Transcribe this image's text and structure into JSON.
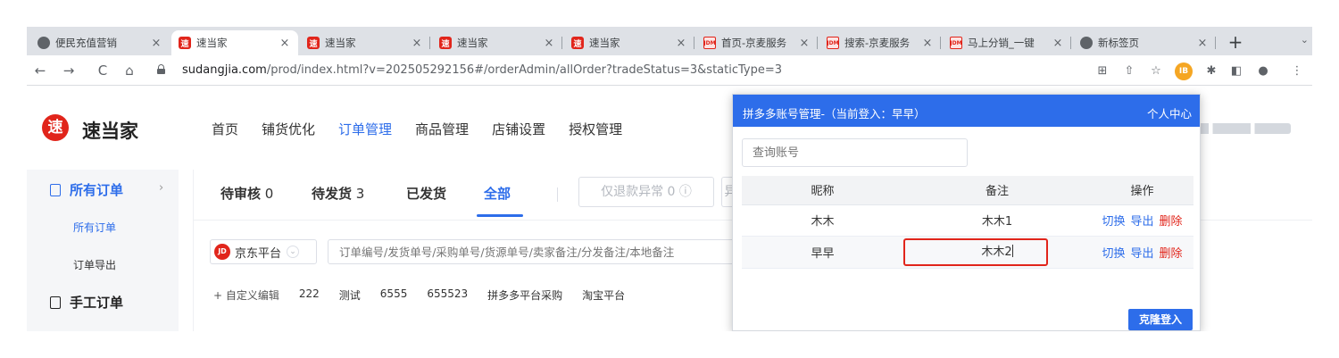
{
  "browser": {
    "tabs": [
      {
        "title": "便民充值营销",
        "icon": "globe-icon",
        "close": "×"
      },
      {
        "title": "速当家",
        "icon": "sudangjia-favicon-icon",
        "close": "×"
      },
      {
        "title": "速当家",
        "icon": "sudangjia-favicon-icon",
        "close": "×"
      },
      {
        "title": "速当家",
        "icon": "sudangjia-favicon-icon",
        "close": "×"
      },
      {
        "title": "速当家",
        "icon": "sudangjia-favicon-icon",
        "close": "×"
      },
      {
        "title": "首页-京麦服务",
        "icon": "jdm-favicon-icon",
        "close": "×"
      },
      {
        "title": "搜索-京麦服务",
        "icon": "jdm-favicon-icon",
        "close": "×"
      },
      {
        "title": "马上分销_一键",
        "icon": "jdm-favicon-icon",
        "close": "×"
      },
      {
        "title": "新标签页",
        "icon": "chrome-icon",
        "close": "×"
      }
    ],
    "active_tab": 1,
    "new_tab": "+",
    "tab_menu": "⌄",
    "favicon_text": "速",
    "jdm_text": "JDM",
    "url_host": "sudangjia.com",
    "url_path": "/prod/index.html?v=202505292156#/orderAdmin/allOrder?tradeStatus=3&staticType=3",
    "nav": {
      "back": "←",
      "forward": "→",
      "reload": "C",
      "home": "⌂"
    },
    "tools": {
      "translate": "⊞",
      "share": "⇧",
      "star": "☆",
      "ext_badge": "IB",
      "puzzle": "✱",
      "sidepanel": "◧",
      "profile": "●",
      "menu": "⋮"
    }
  },
  "app": {
    "logo_char": "速",
    "logo_name": "速当家",
    "nav": [
      "首页",
      "铺货优化",
      "订单管理",
      "商品管理",
      "店铺设置",
      "授权管理"
    ],
    "active_nav": 2,
    "sidebar": {
      "section1": "所有订单",
      "arrow": "›",
      "sub_items": [
        "所有订单",
        "订单导出"
      ],
      "section2": "手工订单"
    },
    "order_tabs": {
      "pending_review": {
        "label": "待审核",
        "count": "0"
      },
      "pending_ship": {
        "label": "待发货",
        "count": "3"
      },
      "shipped": "已发货",
      "all": "全部"
    },
    "refund_exception": "仅退款异常 0 ⓘ",
    "refund_exception_partial": "异",
    "platform": {
      "badge": "JD",
      "label": "京东平台",
      "chevron": "⌄"
    },
    "order_search_placeholder": "订单编号/发货单号/采购单号/货源单号/卖家备注/分发备注/本地备注",
    "tags": [
      "+ 自定义编辑",
      "222",
      "测试",
      "6555",
      "655523",
      "拼多多平台采购",
      "淘宝平台"
    ]
  },
  "popup": {
    "title": "拼多多账号管理-（当前登入：早早）",
    "personal_center": "个人中心",
    "search_placeholder": "查询账号",
    "columns": [
      "昵称",
      "备注",
      "操作"
    ],
    "rows": [
      {
        "nickname": "木木",
        "note": "木木1",
        "switch": "切换",
        "export": "导出",
        "delete": "删除"
      },
      {
        "nickname": "早早",
        "note": "木木2",
        "switch": "切换",
        "export": "导出",
        "delete": "删除"
      }
    ],
    "clone_login": "克隆登入"
  },
  "colors": {
    "accent": "#2d6dea",
    "danger": "#e1251b",
    "brand": "#e1251b"
  }
}
